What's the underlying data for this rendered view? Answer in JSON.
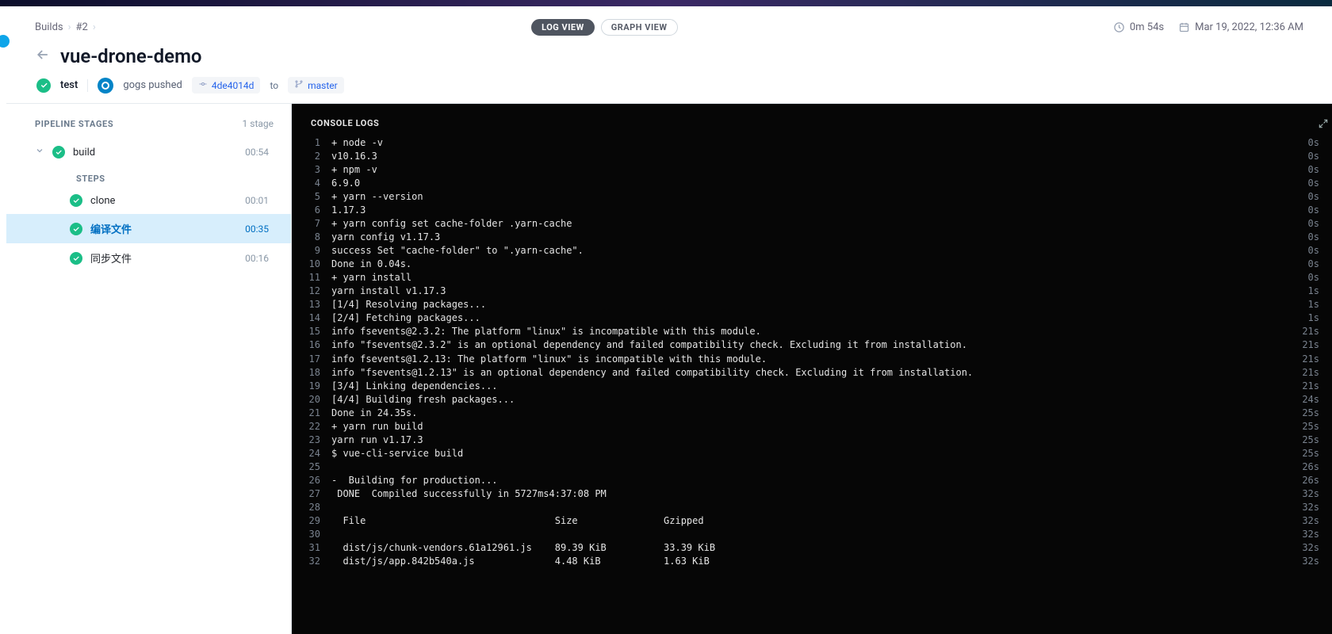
{
  "breadcrumbs": {
    "builds": "Builds",
    "num": "#2"
  },
  "views": {
    "log": "LOG VIEW",
    "graph": "GRAPH VIEW"
  },
  "header_meta": {
    "duration": "0m 54s",
    "date": "Mar 19, 2022, 12:36 AM"
  },
  "title": "vue-drone-demo",
  "sub": {
    "test": "test",
    "pushed": "gogs pushed",
    "commit": "4de4014d",
    "to": "to",
    "branch": "master"
  },
  "stages": {
    "header": "PIPELINE STAGES",
    "count": "1 stage",
    "items": [
      {
        "name": "build",
        "time": "00:54"
      }
    ],
    "steps_label": "STEPS",
    "steps": [
      {
        "name": "clone",
        "time": "00:01",
        "active": false
      },
      {
        "name": "编译文件",
        "time": "00:35",
        "active": true
      },
      {
        "name": "同步文件",
        "time": "00:16",
        "active": false
      }
    ]
  },
  "console": {
    "header": "CONSOLE LOGS",
    "lines": [
      {
        "n": 1,
        "t": "0s",
        "txt": "+ node -v"
      },
      {
        "n": 2,
        "t": "0s",
        "txt": "v10.16.3"
      },
      {
        "n": 3,
        "t": "0s",
        "txt": "+ npm -v"
      },
      {
        "n": 4,
        "t": "0s",
        "txt": "6.9.0"
      },
      {
        "n": 5,
        "t": "0s",
        "txt": "+ yarn --version"
      },
      {
        "n": 6,
        "t": "0s",
        "txt": "1.17.3"
      },
      {
        "n": 7,
        "t": "0s",
        "txt": "+ yarn config set cache-folder .yarn-cache"
      },
      {
        "n": 8,
        "t": "0s",
        "txt": "yarn config v1.17.3"
      },
      {
        "n": 9,
        "t": "0s",
        "txt": "success Set \"cache-folder\" to \".yarn-cache\"."
      },
      {
        "n": 10,
        "t": "0s",
        "txt": "Done in 0.04s."
      },
      {
        "n": 11,
        "t": "0s",
        "txt": "+ yarn install"
      },
      {
        "n": 12,
        "t": "1s",
        "txt": "yarn install v1.17.3"
      },
      {
        "n": 13,
        "t": "1s",
        "txt": "[1/4] Resolving packages..."
      },
      {
        "n": 14,
        "t": "1s",
        "txt": "[2/4] Fetching packages..."
      },
      {
        "n": 15,
        "t": "21s",
        "txt": "info fsevents@2.3.2: The platform \"linux\" is incompatible with this module."
      },
      {
        "n": 16,
        "t": "21s",
        "txt": "info \"fsevents@2.3.2\" is an optional dependency and failed compatibility check. Excluding it from installation."
      },
      {
        "n": 17,
        "t": "21s",
        "txt": "info fsevents@1.2.13: The platform \"linux\" is incompatible with this module."
      },
      {
        "n": 18,
        "t": "21s",
        "txt": "info \"fsevents@1.2.13\" is an optional dependency and failed compatibility check. Excluding it from installation."
      },
      {
        "n": 19,
        "t": "21s",
        "txt": "[3/4] Linking dependencies..."
      },
      {
        "n": 20,
        "t": "24s",
        "txt": "[4/4] Building fresh packages..."
      },
      {
        "n": 21,
        "t": "25s",
        "txt": "Done in 24.35s."
      },
      {
        "n": 22,
        "t": "25s",
        "txt": "+ yarn run build"
      },
      {
        "n": 23,
        "t": "25s",
        "txt": "yarn run v1.17.3"
      },
      {
        "n": 24,
        "t": "25s",
        "txt": "$ vue-cli-service build"
      },
      {
        "n": 25,
        "t": "26s",
        "txt": ""
      },
      {
        "n": 26,
        "t": "26s",
        "txt": "-  Building for production..."
      },
      {
        "n": 27,
        "t": "32s",
        "txt": " DONE  Compiled successfully in 5727ms4:37:08 PM"
      },
      {
        "n": 28,
        "t": "32s",
        "txt": ""
      },
      {
        "n": 29,
        "t": "32s",
        "txt": "  File                                 Size               Gzipped"
      },
      {
        "n": 30,
        "t": "32s",
        "txt": ""
      },
      {
        "n": 31,
        "t": "32s",
        "txt": "  dist/js/chunk-vendors.61a12961.js    89.39 KiB          33.39 KiB"
      },
      {
        "n": 32,
        "t": "32s",
        "txt": "  dist/js/app.842b540a.js              4.48 KiB           1.63 KiB"
      }
    ]
  }
}
